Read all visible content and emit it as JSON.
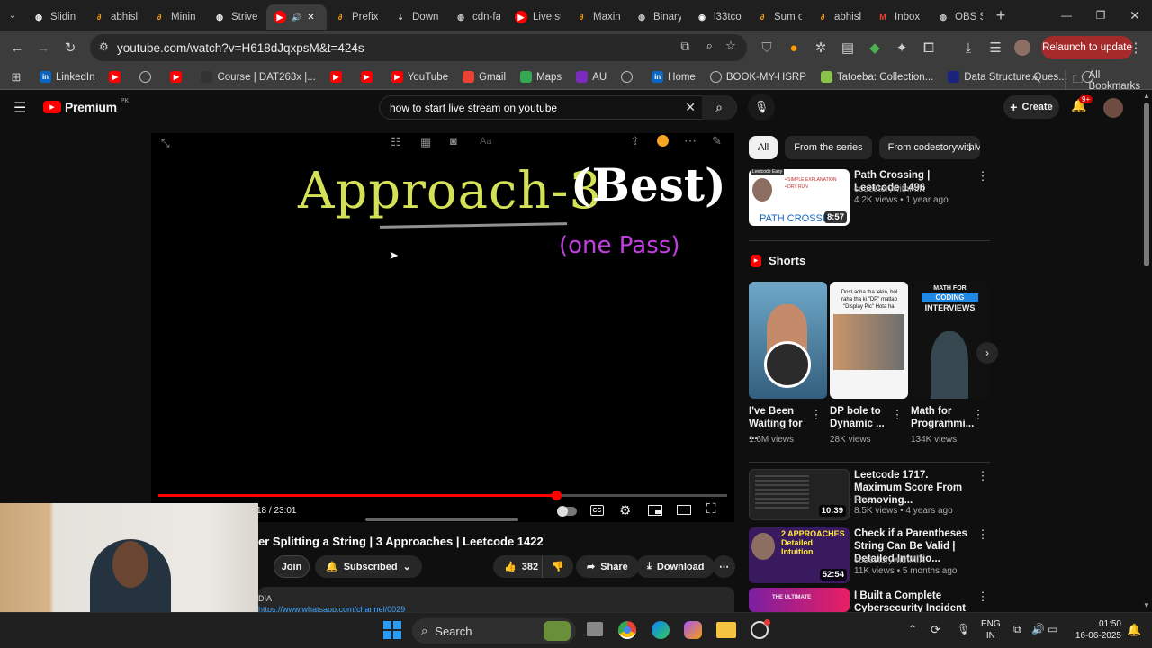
{
  "browser": {
    "tabs": [
      {
        "label": "Slidin",
        "icon": "mc-icon",
        "color": "#ffffff"
      },
      {
        "label": "abhisl",
        "icon": "leetcode-icon",
        "color": "#ffa116"
      },
      {
        "label": "Minin",
        "icon": "leetcode-icon",
        "color": "#ffa116"
      },
      {
        "label": "Strive",
        "icon": "tuf-icon",
        "color": "#ffffff"
      },
      {
        "label": "",
        "icon": "youtube-icon",
        "color": "#ff0000",
        "active": true
      },
      {
        "label": "Prefix",
        "icon": "leetcode-icon",
        "color": "#ffa116"
      },
      {
        "label": "Down",
        "icon": "download-icon",
        "color": "#cccccc"
      },
      {
        "label": "cdn-fa",
        "icon": "globe-icon",
        "color": "#cccccc"
      },
      {
        "label": "Live st",
        "icon": "youtube-icon",
        "color": "#ff0000"
      },
      {
        "label": "Maxin",
        "icon": "leetcode-icon",
        "color": "#ffa116"
      },
      {
        "label": "Binary",
        "icon": "globe-icon",
        "color": "#cccccc"
      },
      {
        "label": "l33tco",
        "icon": "github-icon",
        "color": "#ffffff"
      },
      {
        "label": "Sum o",
        "icon": "leetcode-icon",
        "color": "#ffa116"
      },
      {
        "label": "abhisl",
        "icon": "leetcode-icon",
        "color": "#ffa116"
      },
      {
        "label": "Inbox",
        "icon": "gmail-icon",
        "color": "#ea4335"
      },
      {
        "label": "OBS S",
        "icon": "globe-icon",
        "color": "#cccccc"
      }
    ],
    "new_tab": "+",
    "url": "youtube.com/watch?v=H618dJqxpsM&t=424s",
    "relaunch_label": "Relaunch to update",
    "bookmarks": [
      {
        "label": "LinkedIn",
        "icon": "linkedin-icon",
        "color": "#0a66c2"
      },
      {
        "label": "",
        "icon": "youtube-icon",
        "color": "#ff0000"
      },
      {
        "label": "",
        "icon": "globe-icon",
        "color": "#888888"
      },
      {
        "label": "",
        "icon": "youtube-icon",
        "color": "#ff0000"
      },
      {
        "label": "Course | DAT263x |...",
        "icon": "edx-icon",
        "color": "#333333"
      },
      {
        "label": "",
        "icon": "youtube-icon",
        "color": "#ff0000"
      },
      {
        "label": "",
        "icon": "youtube-icon",
        "color": "#ff0000"
      },
      {
        "label": "YouTube",
        "icon": "youtube-icon",
        "color": "#ff0000"
      },
      {
        "label": "Gmail",
        "icon": "gmail-icon",
        "color": "#ea4335"
      },
      {
        "label": "Maps",
        "icon": "maps-icon",
        "color": "#34a853"
      },
      {
        "label": "AU",
        "icon": "au-icon",
        "color": "#7b2cbf"
      },
      {
        "label": "",
        "icon": "globe-icon",
        "color": "#888888"
      },
      {
        "label": "Home",
        "icon": "linkedin-icon",
        "color": "#0a66c2"
      },
      {
        "label": "BOOK-MY-HSRP",
        "icon": "globe-icon",
        "color": "#888888"
      },
      {
        "label": "Tatoeba: Collection...",
        "icon": "tatoeba-icon",
        "color": "#8bc34a"
      },
      {
        "label": "Data Structure Ques...",
        "icon": "ds-icon",
        "color": "#1a237e"
      },
      {
        "label": "",
        "icon": "globe-icon",
        "color": "#888888"
      }
    ],
    "more_bookmarks": "»",
    "all_bookmarks": "All Bookmarks"
  },
  "youtube": {
    "logo_text": "Premium",
    "region": "PK",
    "search_value": "how to start live stream on youtube",
    "create_label": "Create",
    "notif_badge": "9+",
    "accent": "#ff0000"
  },
  "player": {
    "slide_title": "Approach-3",
    "slide_best": "(Best)",
    "slide_sub": "(one Pass)",
    "time": "18 / 23:01",
    "progress": 0.7,
    "video_title": "er Splitting a String | 3 Approaches | Leetcode 1422",
    "join_label": "Join",
    "subscribed_label": "Subscribed",
    "likes": "382",
    "share_label": "Share",
    "download_label": "Download",
    "desc_prefix": "DIA",
    "desc_link": "https://www.whatsapp.com/channel/0029"
  },
  "sidebar": {
    "chips": [
      {
        "label": "All",
        "selected": true
      },
      {
        "label": "From the series"
      },
      {
        "label": "From codestorywithMIK"
      }
    ],
    "top_video": {
      "title": "Path Crossing | Leetcode 1496",
      "channel": "codestorywithMIK",
      "meta": "4.2K views • 1 year ago",
      "duration": "8:57",
      "thumb_badge": "Leetcode Easy",
      "thumb_lines": [
        "• SIMPLE EXPLANATION",
        "• DRY RUN"
      ],
      "thumb_caption": "PATH CROSSIN"
    },
    "shorts_heading": "Shorts",
    "shorts": [
      {
        "title": "I've Been Waiting for ...",
        "views": "1.6M views"
      },
      {
        "title": "DP bole to Dynamic ...",
        "views": "28K views",
        "thumb_text": "Dost acha tha lekin, bol raha tha ki \"DP\" matlab \"Display Pic\" Hota hai"
      },
      {
        "title": "Math for Programmi...",
        "views": "134K views",
        "thumb_text1": "MATH FOR",
        "thumb_text2": "CODING",
        "thumb_text3": "INTERVIEWS"
      }
    ],
    "videos": [
      {
        "title": "Leetcode 1717. Maximum Score From Removing...",
        "channel": "Fraz",
        "meta": "8.5K views • 4 years ago",
        "duration": "10:39"
      },
      {
        "title": "Check if a Parentheses String Can Be Valid | Detailed Intuitio...",
        "channel": "codestorywithMIK",
        "meta": "11K views • 5 months ago",
        "duration": "52:54",
        "thumb_text": "2 APPROACHES Detailed Intuition"
      },
      {
        "title": "I Built a Complete Cybersecurity Incident Tracker with Python |",
        "channel": "",
        "meta": "",
        "duration": "",
        "thumb_text": "THE ULTIMATE"
      }
    ]
  },
  "taskbar": {
    "search_label": "Search",
    "lang1": "ENG",
    "lang2": "IN",
    "time": "01:50",
    "date": "16-06-2025"
  }
}
